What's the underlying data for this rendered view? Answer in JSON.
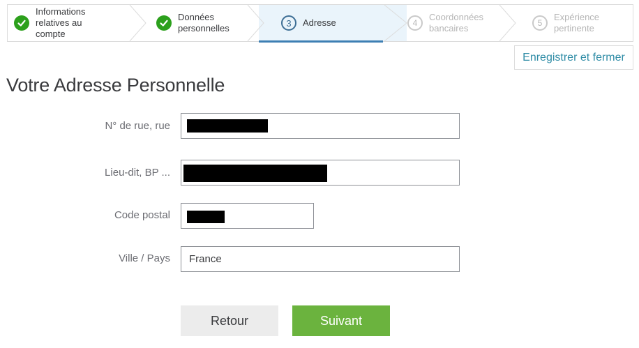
{
  "stepper": {
    "steps": [
      {
        "number": "",
        "label_lines": [
          "Informations",
          "relatives au",
          "compte"
        ],
        "state": "done"
      },
      {
        "number": "",
        "label_lines": [
          "Données",
          "personnelles"
        ],
        "state": "done"
      },
      {
        "number": "3",
        "label_lines": [
          "Adresse"
        ],
        "state": "active"
      },
      {
        "number": "4",
        "label_lines": [
          "Coordonnées",
          "bancaires"
        ],
        "state": "todo"
      },
      {
        "number": "5",
        "label_lines": [
          "Expérience",
          "pertinente"
        ],
        "state": "todo"
      }
    ],
    "colors": {
      "done": "#2ca01c",
      "active": "#3d6e95",
      "todo": "#c9c9c9"
    }
  },
  "header": {
    "save_close_label": "Enregistrer et fermer",
    "title": "Votre Adresse Personnelle"
  },
  "form": {
    "street_label": "N° de rue, rue",
    "locality_label": "Lieu-dit, BP ...",
    "postal_label": "Code postal",
    "city_label": "Ville / Pays",
    "city_value": "France"
  },
  "buttons": {
    "back_label": "Retour",
    "next_label": "Suivant"
  },
  "colors": {
    "accent": "#2f8ca6",
    "primary_button": "#6bb33e",
    "secondary_button": "#ececec"
  }
}
